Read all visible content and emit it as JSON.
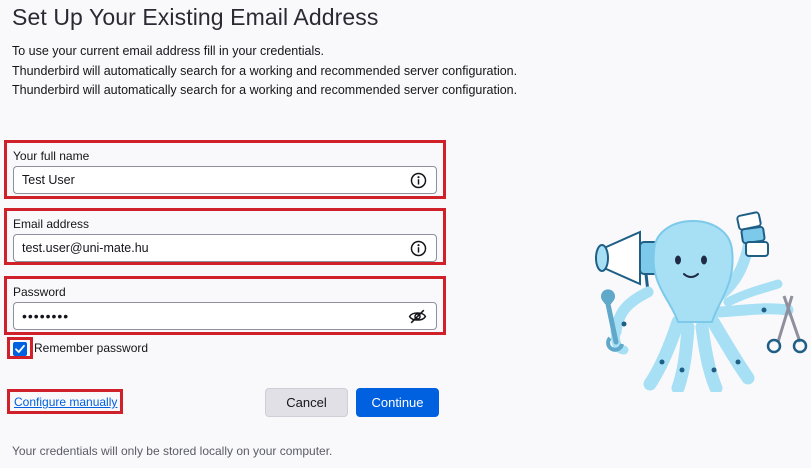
{
  "page": {
    "title": "Set Up Your Existing Email Address",
    "intro_lines": [
      "To use your current email address fill in your credentials.",
      "Thunderbird will automatically search for a working and recommended server configuration.",
      "Thunderbird will automatically search for a working and recommended server configuration."
    ]
  },
  "form": {
    "full_name": {
      "label": "Your full name",
      "value": "Test User",
      "icon": "info-icon"
    },
    "email": {
      "label": "Email address",
      "value": "test.user@uni-mate.hu",
      "icon": "info-icon"
    },
    "password": {
      "label": "Password",
      "value": "••••••••",
      "icon": "eye-slash-icon"
    },
    "remember": {
      "label": "Remember password",
      "checked": true
    }
  },
  "actions": {
    "configure_manually": "Configure manually",
    "cancel": "Cancel",
    "continue": "Continue"
  },
  "footer": {
    "note": "Your credentials will only be stored locally on your computer."
  },
  "colors": {
    "accent": "#0061e0",
    "highlight_border": "#d0202a",
    "mascot": "#a7e0f5"
  }
}
